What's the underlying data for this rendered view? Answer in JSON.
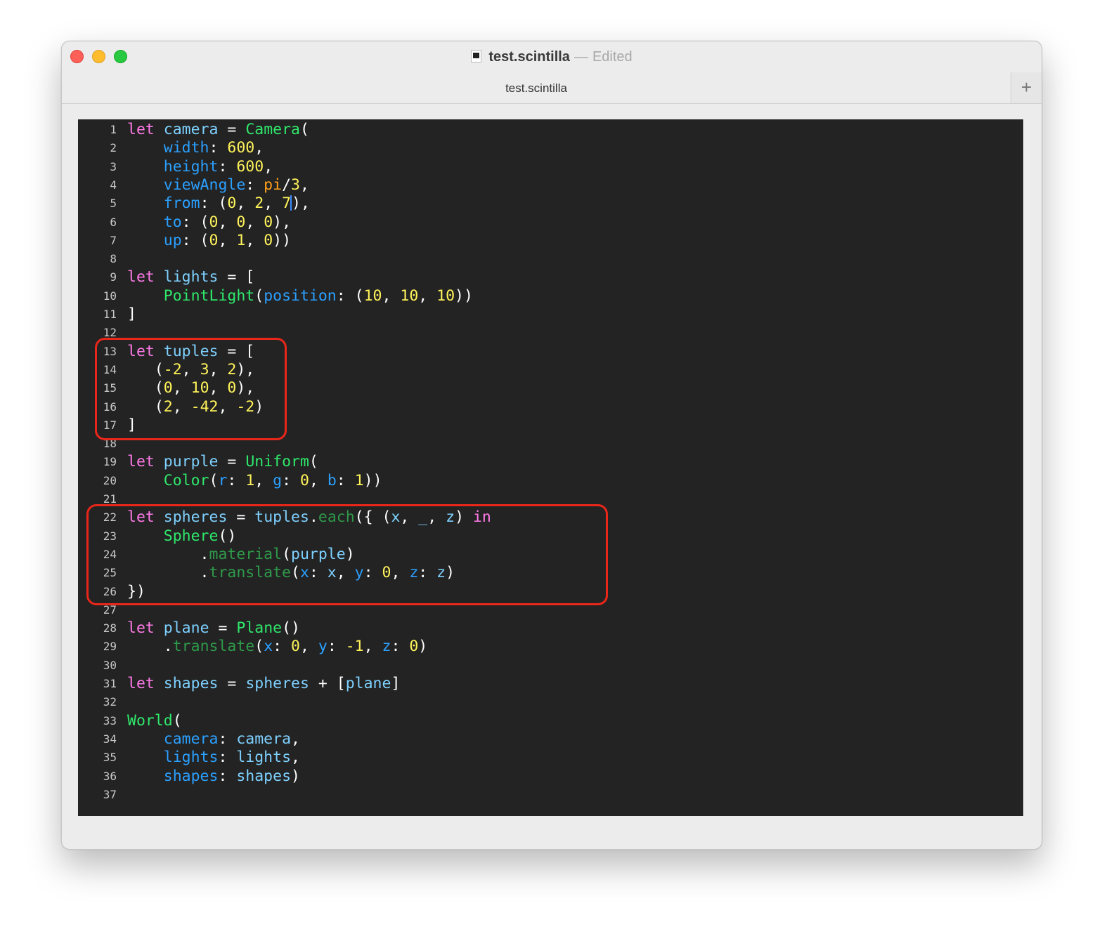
{
  "window": {
    "title": "test.scintilla",
    "title_separator": "—",
    "edited_label": "Edited",
    "tab_label": "test.scintilla",
    "new_tab_symbol": "+"
  },
  "icons": [
    "document-icon",
    "close-button",
    "minimize-button",
    "zoom-button",
    "plus-icon"
  ],
  "colors": {
    "editor_background": "#232323",
    "keyword": "#ff7ae8",
    "identifier": "#7ed1ff",
    "type": "#2fe86b",
    "number": "#fff35a",
    "label": "#2ba0ff",
    "constant": "#ff9f1a",
    "method": "#2e9a4a",
    "annotation_box": "#e8261a"
  },
  "editor": {
    "cursor_line": 5,
    "lines": [
      {
        "n": "1",
        "t": [
          [
            "kw",
            "let"
          ],
          [
            "p",
            " "
          ],
          [
            "id",
            "camera"
          ],
          [
            "p",
            " = "
          ],
          [
            "ty",
            "Camera"
          ],
          [
            "p",
            "("
          ]
        ]
      },
      {
        "n": "2",
        "t": [
          [
            "p",
            "    "
          ],
          [
            "lbl",
            "width"
          ],
          [
            "p",
            ": "
          ],
          [
            "num",
            "600"
          ],
          [
            "p",
            ","
          ]
        ]
      },
      {
        "n": "3",
        "t": [
          [
            "p",
            "    "
          ],
          [
            "lbl",
            "height"
          ],
          [
            "p",
            ": "
          ],
          [
            "num",
            "600"
          ],
          [
            "p",
            ","
          ]
        ]
      },
      {
        "n": "4",
        "t": [
          [
            "p",
            "    "
          ],
          [
            "lbl",
            "viewAngle"
          ],
          [
            "p",
            ": "
          ],
          [
            "pi",
            "pi"
          ],
          [
            "p",
            "/"
          ],
          [
            "num",
            "3"
          ],
          [
            "p",
            ","
          ]
        ]
      },
      {
        "n": "5",
        "t": [
          [
            "p",
            "    "
          ],
          [
            "lbl",
            "from"
          ],
          [
            "p",
            ": ("
          ],
          [
            "num",
            "0"
          ],
          [
            "p",
            ", "
          ],
          [
            "num",
            "2"
          ],
          [
            "p",
            ", "
          ],
          [
            "num",
            "7"
          ],
          [
            "cursor",
            ""
          ],
          [
            "p",
            "),"
          ]
        ]
      },
      {
        "n": "6",
        "t": [
          [
            "p",
            "    "
          ],
          [
            "lbl",
            "to"
          ],
          [
            "p",
            ": ("
          ],
          [
            "num",
            "0"
          ],
          [
            "p",
            ", "
          ],
          [
            "num",
            "0"
          ],
          [
            "p",
            ", "
          ],
          [
            "num",
            "0"
          ],
          [
            "p",
            "),"
          ]
        ]
      },
      {
        "n": "7",
        "t": [
          [
            "p",
            "    "
          ],
          [
            "lbl",
            "up"
          ],
          [
            "p",
            ": ("
          ],
          [
            "num",
            "0"
          ],
          [
            "p",
            ", "
          ],
          [
            "num",
            "1"
          ],
          [
            "p",
            ", "
          ],
          [
            "num",
            "0"
          ],
          [
            "p",
            "))"
          ]
        ]
      },
      {
        "n": "8",
        "t": []
      },
      {
        "n": "9",
        "t": [
          [
            "kw",
            "let"
          ],
          [
            "p",
            " "
          ],
          [
            "id",
            "lights"
          ],
          [
            "p",
            " = ["
          ]
        ]
      },
      {
        "n": "10",
        "t": [
          [
            "p",
            "    "
          ],
          [
            "ty",
            "PointLight"
          ],
          [
            "p",
            "("
          ],
          [
            "lbl",
            "position"
          ],
          [
            "p",
            ": ("
          ],
          [
            "num",
            "10"
          ],
          [
            "p",
            ", "
          ],
          [
            "num",
            "10"
          ],
          [
            "p",
            ", "
          ],
          [
            "num",
            "10"
          ],
          [
            "p",
            "))"
          ]
        ]
      },
      {
        "n": "11",
        "t": [
          [
            "p",
            "]"
          ]
        ]
      },
      {
        "n": "12",
        "t": []
      },
      {
        "n": "13",
        "t": [
          [
            "kw",
            "let"
          ],
          [
            "p",
            " "
          ],
          [
            "id",
            "tuples"
          ],
          [
            "p",
            " = ["
          ]
        ]
      },
      {
        "n": "14",
        "t": [
          [
            "p",
            "   ("
          ],
          [
            "num",
            "-2"
          ],
          [
            "p",
            ", "
          ],
          [
            "num",
            "3"
          ],
          [
            "p",
            ", "
          ],
          [
            "num",
            "2"
          ],
          [
            "p",
            "),"
          ]
        ]
      },
      {
        "n": "15",
        "t": [
          [
            "p",
            "   ("
          ],
          [
            "num",
            "0"
          ],
          [
            "p",
            ", "
          ],
          [
            "num",
            "10"
          ],
          [
            "p",
            ", "
          ],
          [
            "num",
            "0"
          ],
          [
            "p",
            "),"
          ]
        ]
      },
      {
        "n": "16",
        "t": [
          [
            "p",
            "   ("
          ],
          [
            "num",
            "2"
          ],
          [
            "p",
            ", "
          ],
          [
            "num",
            "-42"
          ],
          [
            "p",
            ", "
          ],
          [
            "num",
            "-2"
          ],
          [
            "p",
            ")"
          ]
        ]
      },
      {
        "n": "17",
        "t": [
          [
            "p",
            "]"
          ]
        ]
      },
      {
        "n": "18",
        "t": []
      },
      {
        "n": "19",
        "t": [
          [
            "kw",
            "let"
          ],
          [
            "p",
            " "
          ],
          [
            "id",
            "purple"
          ],
          [
            "p",
            " = "
          ],
          [
            "ty",
            "Uniform"
          ],
          [
            "p",
            "("
          ]
        ]
      },
      {
        "n": "20",
        "t": [
          [
            "p",
            "    "
          ],
          [
            "ty",
            "Color"
          ],
          [
            "p",
            "("
          ],
          [
            "lbl",
            "r"
          ],
          [
            "p",
            ": "
          ],
          [
            "num",
            "1"
          ],
          [
            "p",
            ", "
          ],
          [
            "lbl",
            "g"
          ],
          [
            "p",
            ": "
          ],
          [
            "num",
            "0"
          ],
          [
            "p",
            ", "
          ],
          [
            "lbl",
            "b"
          ],
          [
            "p",
            ": "
          ],
          [
            "num",
            "1"
          ],
          [
            "p",
            "))"
          ]
        ]
      },
      {
        "n": "21",
        "t": []
      },
      {
        "n": "22",
        "t": [
          [
            "kw",
            "let"
          ],
          [
            "p",
            " "
          ],
          [
            "id",
            "spheres"
          ],
          [
            "p",
            " = "
          ],
          [
            "id",
            "tuples"
          ],
          [
            "p",
            "."
          ],
          [
            "mth",
            "each"
          ],
          [
            "p",
            "({ ("
          ],
          [
            "id",
            "x"
          ],
          [
            "p",
            ", "
          ],
          [
            "id",
            "_"
          ],
          [
            "p",
            ", "
          ],
          [
            "id",
            "z"
          ],
          [
            "p",
            ") "
          ],
          [
            "kw",
            "in"
          ]
        ]
      },
      {
        "n": "23",
        "t": [
          [
            "p",
            "    "
          ],
          [
            "ty",
            "Sphere"
          ],
          [
            "p",
            "()"
          ]
        ]
      },
      {
        "n": "24",
        "t": [
          [
            "p",
            "        ."
          ],
          [
            "mth",
            "material"
          ],
          [
            "p",
            "("
          ],
          [
            "id",
            "purple"
          ],
          [
            "p",
            ")"
          ]
        ]
      },
      {
        "n": "25",
        "t": [
          [
            "p",
            "        ."
          ],
          [
            "mth",
            "translate"
          ],
          [
            "p",
            "("
          ],
          [
            "lbl",
            "x"
          ],
          [
            "p",
            ": "
          ],
          [
            "id",
            "x"
          ],
          [
            "p",
            ", "
          ],
          [
            "lbl",
            "y"
          ],
          [
            "p",
            ": "
          ],
          [
            "num",
            "0"
          ],
          [
            "p",
            ", "
          ],
          [
            "lbl",
            "z"
          ],
          [
            "p",
            ": "
          ],
          [
            "id",
            "z"
          ],
          [
            "p",
            ")"
          ]
        ]
      },
      {
        "n": "26",
        "t": [
          [
            "p",
            "})"
          ]
        ]
      },
      {
        "n": "27",
        "t": []
      },
      {
        "n": "28",
        "t": [
          [
            "kw",
            "let"
          ],
          [
            "p",
            " "
          ],
          [
            "id",
            "plane"
          ],
          [
            "p",
            " = "
          ],
          [
            "ty",
            "Plane"
          ],
          [
            "p",
            "()"
          ]
        ]
      },
      {
        "n": "29",
        "t": [
          [
            "p",
            "    ."
          ],
          [
            "mth",
            "translate"
          ],
          [
            "p",
            "("
          ],
          [
            "lbl",
            "x"
          ],
          [
            "p",
            ": "
          ],
          [
            "num",
            "0"
          ],
          [
            "p",
            ", "
          ],
          [
            "lbl",
            "y"
          ],
          [
            "p",
            ": "
          ],
          [
            "num",
            "-1"
          ],
          [
            "p",
            ", "
          ],
          [
            "lbl",
            "z"
          ],
          [
            "p",
            ": "
          ],
          [
            "num",
            "0"
          ],
          [
            "p",
            ")"
          ]
        ]
      },
      {
        "n": "30",
        "t": []
      },
      {
        "n": "31",
        "t": [
          [
            "kw",
            "let"
          ],
          [
            "p",
            " "
          ],
          [
            "id",
            "shapes"
          ],
          [
            "p",
            " = "
          ],
          [
            "id",
            "spheres"
          ],
          [
            "p",
            " + ["
          ],
          [
            "id",
            "plane"
          ],
          [
            "p",
            "]"
          ]
        ]
      },
      {
        "n": "32",
        "t": []
      },
      {
        "n": "33",
        "t": [
          [
            "ty",
            "World"
          ],
          [
            "p",
            "("
          ]
        ]
      },
      {
        "n": "34",
        "t": [
          [
            "p",
            "    "
          ],
          [
            "lbl",
            "camera"
          ],
          [
            "p",
            ": "
          ],
          [
            "id",
            "camera"
          ],
          [
            "p",
            ","
          ]
        ]
      },
      {
        "n": "35",
        "t": [
          [
            "p",
            "    "
          ],
          [
            "lbl",
            "lights"
          ],
          [
            "p",
            ": "
          ],
          [
            "id",
            "lights"
          ],
          [
            "p",
            ","
          ]
        ]
      },
      {
        "n": "36",
        "t": [
          [
            "p",
            "    "
          ],
          [
            "lbl",
            "shapes"
          ],
          [
            "p",
            ": "
          ],
          [
            "id",
            "shapes"
          ],
          [
            "p",
            ")"
          ]
        ]
      },
      {
        "n": "37",
        "t": []
      }
    ]
  }
}
